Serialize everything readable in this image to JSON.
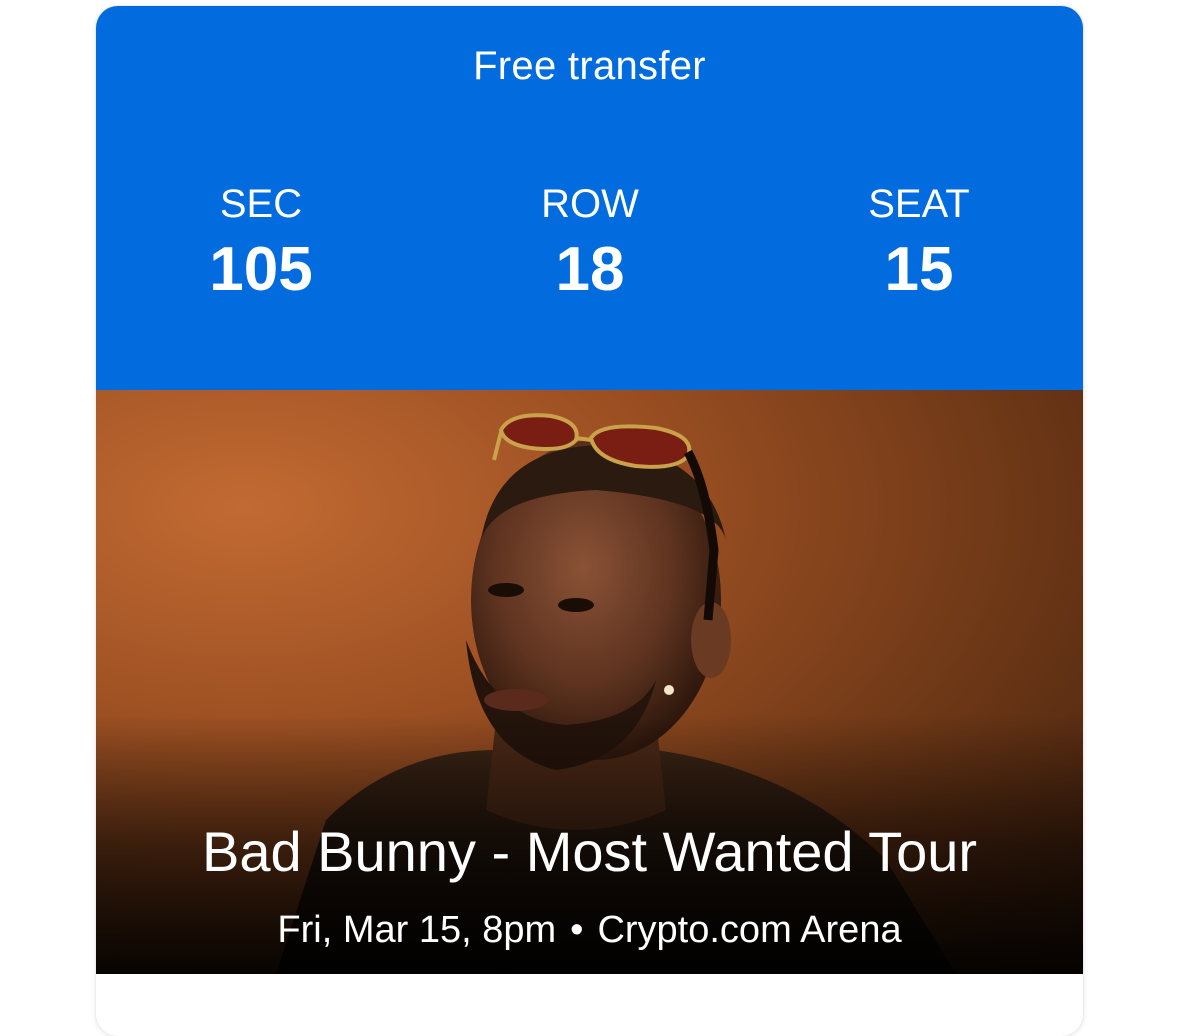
{
  "ticket": {
    "transfer_label": "Free transfer",
    "section": {
      "label": "SEC",
      "value": "105"
    },
    "row": {
      "label": "ROW",
      "value": "18"
    },
    "seat": {
      "label": "SEAT",
      "value": "15"
    },
    "header_color": "#026cdf"
  },
  "event": {
    "title": "Bad Bunny - Most Wanted Tour",
    "date_time": "Fri, Mar 15, 8pm",
    "separator": "•",
    "venue": "Crypto.com Arena"
  }
}
